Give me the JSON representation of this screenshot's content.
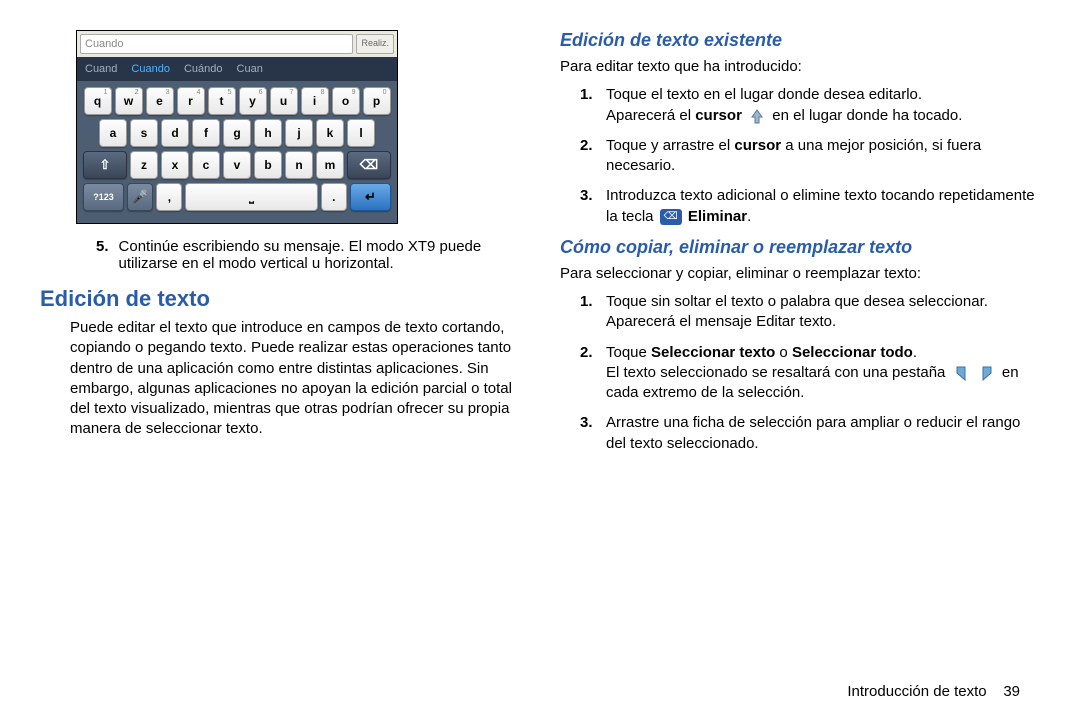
{
  "footer": {
    "label": "Introducción de texto",
    "page": "39"
  },
  "kbd": {
    "input_text": "Cuando",
    "done_label": "Realiz.",
    "suggestions": [
      "Cuand",
      "Cuando",
      "Cuándo",
      "Cuan"
    ],
    "row1": [
      {
        "k": "q",
        "n": "1"
      },
      {
        "k": "w",
        "n": "2"
      },
      {
        "k": "e",
        "n": "3"
      },
      {
        "k": "r",
        "n": "4"
      },
      {
        "k": "t",
        "n": "5"
      },
      {
        "k": "y",
        "n": "6"
      },
      {
        "k": "u",
        "n": "7"
      },
      {
        "k": "i",
        "n": "8"
      },
      {
        "k": "o",
        "n": "9"
      },
      {
        "k": "p",
        "n": "0"
      }
    ],
    "row2": [
      "a",
      "s",
      "d",
      "f",
      "g",
      "h",
      "j",
      "k",
      "l"
    ],
    "row3": [
      "z",
      "x",
      "c",
      "v",
      "b",
      "n",
      "m"
    ],
    "sym_label": "?123",
    "period": ".",
    "comma": ","
  },
  "left": {
    "item5_num": "5.",
    "item5": "Continúe escribiendo su mensaje. El modo XT9 puede utilizarse en el modo vertical u horizontal.",
    "h2": "Edición de texto",
    "p1": "Puede editar el texto que introduce en campos de texto cortando, copiando o pegando texto. Puede realizar estas operaciones tanto dentro de una aplicación como entre distintas aplicaciones. Sin embargo, algunas aplicaciones no apoyan la edición parcial o total del texto visualizado, mientras que otras podrían ofrecer su propia manera de seleccionar texto."
  },
  "right": {
    "h3a": "Edición de texto existente",
    "intro_a": "Para editar texto que ha introducido:",
    "a1_a": "Toque el texto en el lugar donde desea editarlo.",
    "a1_b_pre": "Aparecerá el ",
    "a1_b_bold": "cursor",
    "a1_b_post": " en el lugar donde ha tocado.",
    "a2_pre": "Toque y arrastre el ",
    "a2_bold": "cursor",
    "a2_post": " a una mejor posición, si fuera necesario.",
    "a3_pre": "Introduzca texto adicional o elimine texto tocando repetidamente la tecla ",
    "a3_bold": "Eliminar",
    "a3_post": ".",
    "h3b": "Cómo copiar, eliminar o reemplazar texto",
    "intro_b": "Para seleccionar y copiar, eliminar o reemplazar texto:",
    "b1_a": "Toque sin soltar el texto o palabra que desea seleccionar.",
    "b1_b": "Aparecerá el mensaje Editar texto.",
    "b2_pre": "Toque ",
    "b2_bold1": "Seleccionar texto",
    "b2_mid": " o ",
    "b2_bold2": "Seleccionar todo",
    "b2_post": ".",
    "b2_b_pre": "El texto seleccionado se resaltará con una pestaña ",
    "b2_b_post": " en cada extremo de la selección.",
    "b3": "Arrastre una ficha de selección para ampliar o reducir el rango del texto seleccionado."
  }
}
